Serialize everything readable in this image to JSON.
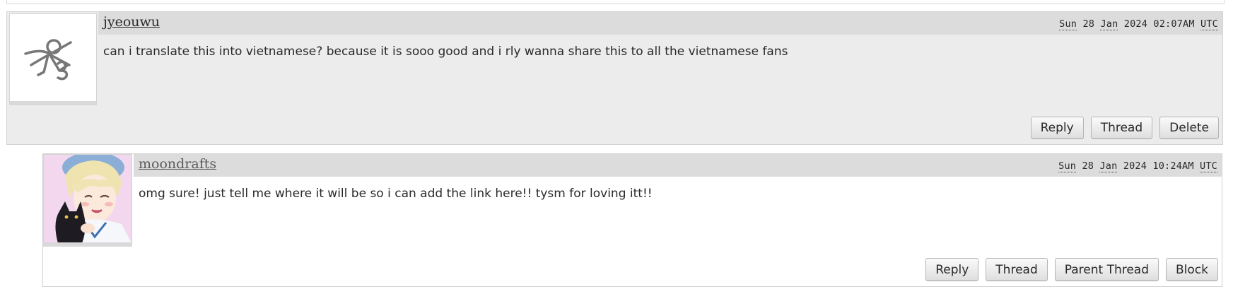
{
  "comments": [
    {
      "author": "jyeouwu",
      "date": {
        "weekday": "Sun",
        "day": "28",
        "month": "Jan",
        "year": "2024",
        "time": "02:07AM",
        "tz": "UTC"
      },
      "text": "can i translate this into vietnamese? because it is sooo good and i rly wanna share this to all the vietnamese fans",
      "avatar_icon": "sketch-logo-icon",
      "actions": [
        "Reply",
        "Thread",
        "Delete"
      ]
    },
    {
      "author": "moondrafts",
      "date": {
        "weekday": "Sun",
        "day": "28",
        "month": "Jan",
        "year": "2024",
        "time": "10:24AM",
        "tz": "UTC"
      },
      "text": "omg sure! just tell me where it will be so i can add the link here!! tysm for loving itt!!",
      "avatar_icon": "anime-portrait-with-cat",
      "actions": [
        "Reply",
        "Thread",
        "Parent Thread",
        "Block"
      ]
    }
  ],
  "colors": {
    "header_bg": "#dcdcdc",
    "comment_bg": "#ececec",
    "reply_bg": "#ffffff",
    "border": "#d2d2d2"
  }
}
